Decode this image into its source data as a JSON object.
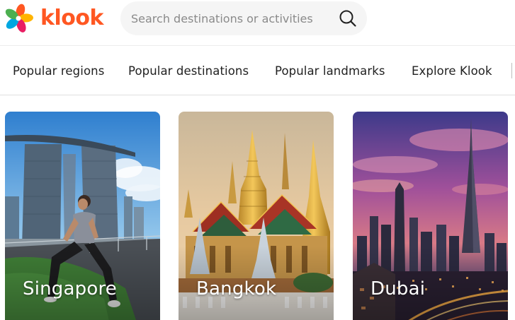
{
  "brand": {
    "name": "klook",
    "color": "#ff5722",
    "logo_icon": "klook-pinwheel-icon"
  },
  "search": {
    "placeholder": "Search destinations or activities",
    "icon": "search-icon"
  },
  "nav": {
    "items": [
      {
        "label": "Popular regions"
      },
      {
        "label": "Popular destinations"
      },
      {
        "label": "Popular landmarks"
      },
      {
        "label": "Explore Klook"
      }
    ]
  },
  "destinations": [
    {
      "name": "Singapore"
    },
    {
      "name": "Bangkok"
    },
    {
      "name": "Dubai"
    }
  ]
}
